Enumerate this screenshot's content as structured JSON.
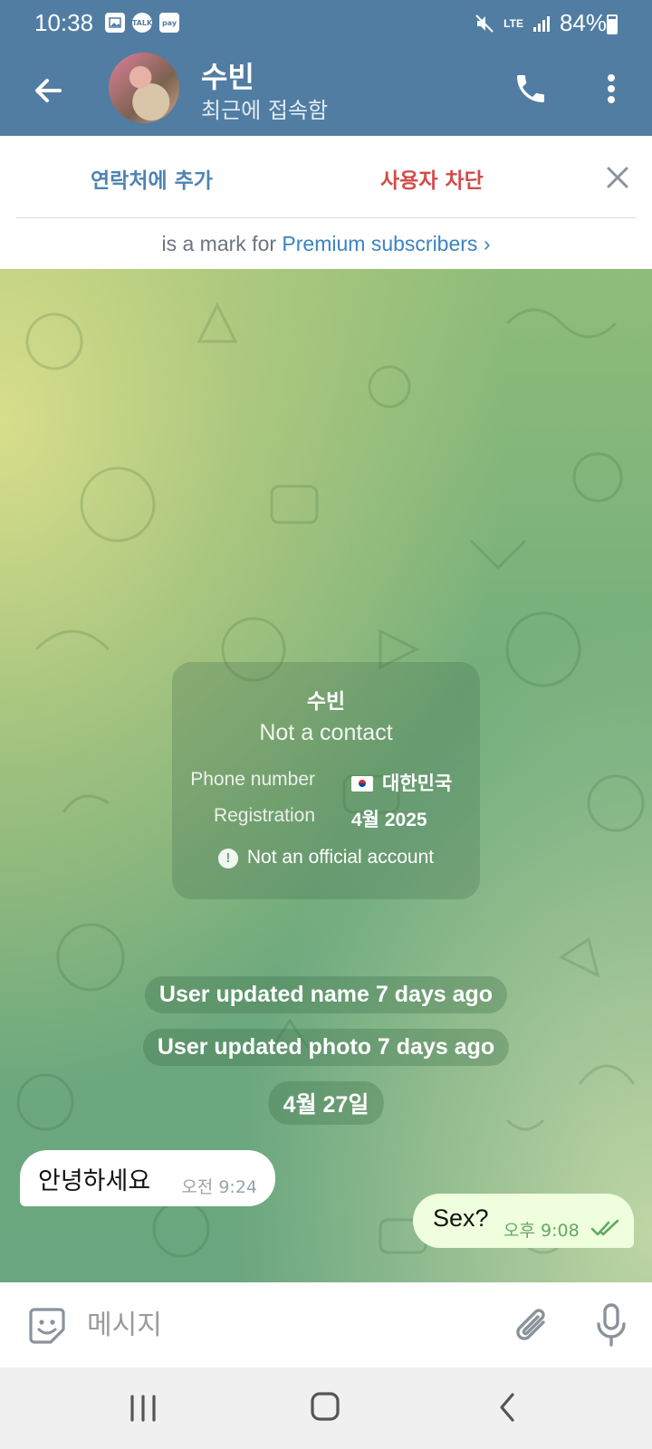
{
  "status_bar": {
    "time": "10:38",
    "notif_talk": "TALK",
    "notif_pay": "pay",
    "network": "LTE",
    "battery": "84%",
    "battery_level": 0.84
  },
  "header": {
    "name": "수빈",
    "status": "최근에 접속함"
  },
  "action_bar": {
    "add_contact": "연락처에 추가",
    "block_user": "사용자 차단"
  },
  "premium_note": {
    "prefix": "is a mark for",
    "link": "Premium subscribers",
    "chevron": "›"
  },
  "info_card": {
    "name": "수빈",
    "subtitle": "Not a contact",
    "phone_label": "Phone number",
    "phone_value": "대한민국",
    "registration_label": "Registration",
    "registration_value": "4월 2025",
    "warning": "Not an official account"
  },
  "service_messages": [
    "User updated name 7 days ago",
    "User updated photo 7 days ago"
  ],
  "date_chip": "4월 27일",
  "messages": [
    {
      "direction": "in",
      "text": "안녕하세요",
      "time": "오전 9:24"
    },
    {
      "direction": "out",
      "text": "Sex?",
      "time": "오후 9:08",
      "read": true
    }
  ],
  "input": {
    "placeholder": "메시지"
  },
  "colors": {
    "header": "#517da2",
    "add_contact": "#4e84b3",
    "block_user": "#d24b4b",
    "link": "#3b83c2",
    "outgoing_bubble": "#effedd",
    "read_check": "#63a963"
  }
}
